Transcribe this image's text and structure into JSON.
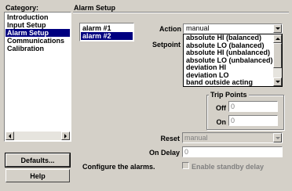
{
  "category": {
    "title": "Category:",
    "items": [
      {
        "label": "Introduction",
        "selected": false
      },
      {
        "label": "Input Setup",
        "selected": false
      },
      {
        "label": "Alarm Setup",
        "selected": true
      },
      {
        "label": "Communications",
        "selected": false
      },
      {
        "label": "Calibration",
        "selected": false
      }
    ]
  },
  "panel": {
    "title": "Alarm Setup"
  },
  "alarms": {
    "items": [
      {
        "label": "alarm #1",
        "selected": false
      },
      {
        "label": "alarm #2",
        "selected": true
      }
    ]
  },
  "action": {
    "label": "Action",
    "value": "manual",
    "options": [
      "absolute HI (balanced)",
      "absolute LO (balanced)",
      "absolute HI (unbalanced)",
      "absolute LO (unbalanced)",
      "deviation HI",
      "deviation LO",
      "band outside acting"
    ]
  },
  "setpoint": {
    "label": "Setpoint"
  },
  "trip_points": {
    "title": "Trip Points",
    "off_label": "Off",
    "off_value": "0",
    "on_label": "On",
    "on_value": "0"
  },
  "reset": {
    "label": "Reset",
    "value": "manual"
  },
  "on_delay": {
    "label": "On Delay",
    "value": "0"
  },
  "standby": {
    "label": "Enable standby delay",
    "checked": false
  },
  "hint": "Configure the alarms.",
  "buttons": {
    "defaults": "Defaults...",
    "help": "Help"
  },
  "colors": {
    "window": "#d4d0c8",
    "selection": "#000080"
  }
}
